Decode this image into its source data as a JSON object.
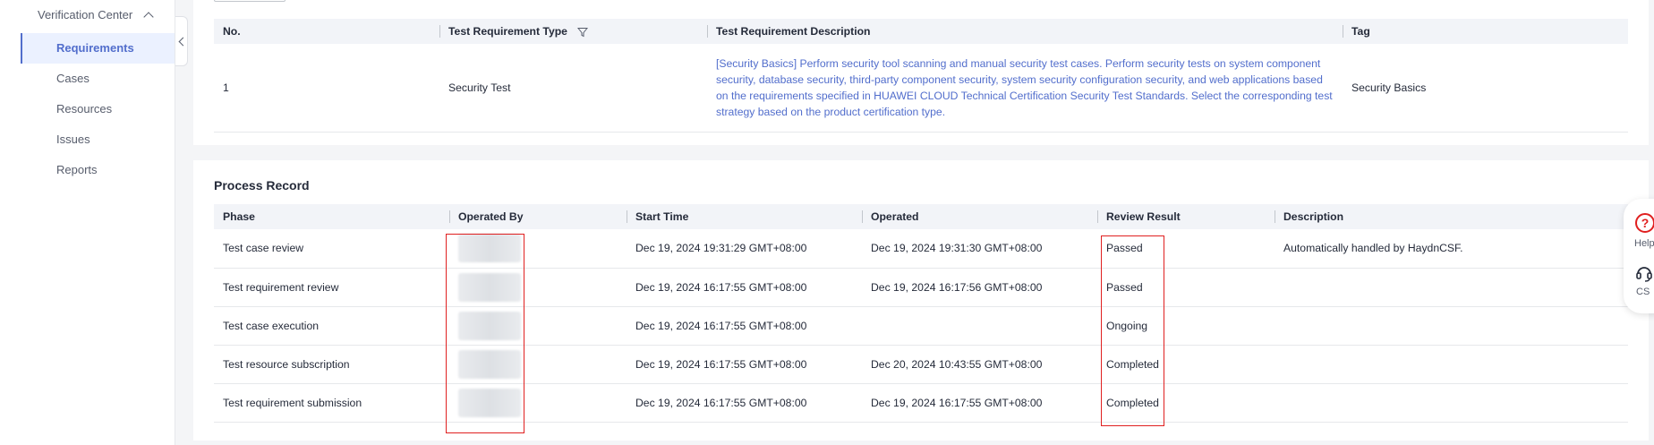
{
  "sidebar": {
    "group_label": "Verification Center",
    "items": [
      {
        "label": "Requirements",
        "active": true
      },
      {
        "label": "Cases",
        "active": false
      },
      {
        "label": "Resources",
        "active": false
      },
      {
        "label": "Issues",
        "active": false
      },
      {
        "label": "Reports",
        "active": false
      }
    ]
  },
  "requirements_table": {
    "headers": [
      "No.",
      "Test Requirement Type",
      "Test Requirement Description",
      "Tag"
    ],
    "rows": [
      {
        "no": "1",
        "type": "Security Test",
        "description": "[Security Basics] Perform security tool scanning and manual security test cases. Perform security tests on system component security, database security, third-party component security, system security configuration security, and web applications based on the requirements specified in HUAWEI CLOUD Technical Certification Security Test Standards. Select the corresponding test strategy based on the product certification type.",
        "tag": "Security Basics"
      }
    ]
  },
  "process_record": {
    "title": "Process Record",
    "headers": [
      "Phase",
      "Operated By",
      "Start Time",
      "Operated",
      "Review Result",
      "Description"
    ],
    "rows": [
      {
        "phase": "Test case review",
        "start": "Dec 19, 2024 19:31:29 GMT+08:00",
        "operated": "Dec 19, 2024 19:31:30 GMT+08:00",
        "result": "Passed",
        "description": "Automatically handled by HaydnCSF."
      },
      {
        "phase": "Test requirement review",
        "start": "Dec 19, 2024 16:17:55 GMT+08:00",
        "operated": "Dec 19, 2024 16:17:56 GMT+08:00",
        "result": "Passed",
        "description": ""
      },
      {
        "phase": "Test case execution",
        "start": "Dec 19, 2024 16:17:55 GMT+08:00",
        "operated": "",
        "result": "Ongoing",
        "description": ""
      },
      {
        "phase": "Test resource subscription",
        "start": "Dec 19, 2024 16:17:55 GMT+08:00",
        "operated": "Dec 20, 2024 10:43:55 GMT+08:00",
        "result": "Completed",
        "description": ""
      },
      {
        "phase": "Test requirement submission",
        "start": "Dec 19, 2024 16:17:55 GMT+08:00",
        "operated": "Dec 19, 2024 16:17:55 GMT+08:00",
        "result": "Completed",
        "description": ""
      }
    ]
  },
  "float_panel": {
    "help_label": "Help",
    "cs_label": "CS"
  },
  "colors": {
    "accent": "#526ecc",
    "highlight": "#e02020"
  }
}
